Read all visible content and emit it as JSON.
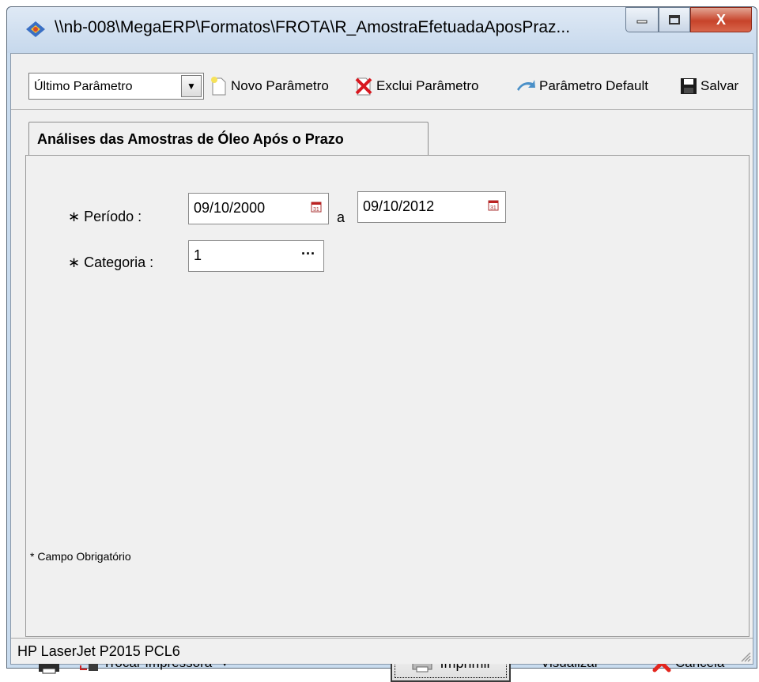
{
  "window": {
    "title": "\\\\nb-008\\MegaERP\\Formatos\\FROTA\\R_AmostraEfetuadaAposPraz...",
    "minimize": "—",
    "maximize": "▭",
    "close": "X"
  },
  "toolbar": {
    "param_select": "Último Parâmetro",
    "new_param": "Novo Parâmetro",
    "delete_param": "Exclui Parâmetro",
    "default_param": "Parâmetro Default",
    "save": "Salvar"
  },
  "tab": {
    "label": "Análises das Amostras de Óleo Após o Prazo"
  },
  "form": {
    "period_label": "∗ Período :",
    "period_from": "09/10/2000",
    "period_sep": "a",
    "period_to": "09/10/2012",
    "category_label": "∗ Categoria :",
    "category_value": "1",
    "required_note": "* Campo Obrigatório"
  },
  "bottom": {
    "change_printer": "Trocar Impressora",
    "print": "Imprimir",
    "preview": "Visualizar",
    "cancel": "Cancela"
  },
  "status": {
    "printer": "HP LaserJet P2015 PCL6"
  }
}
